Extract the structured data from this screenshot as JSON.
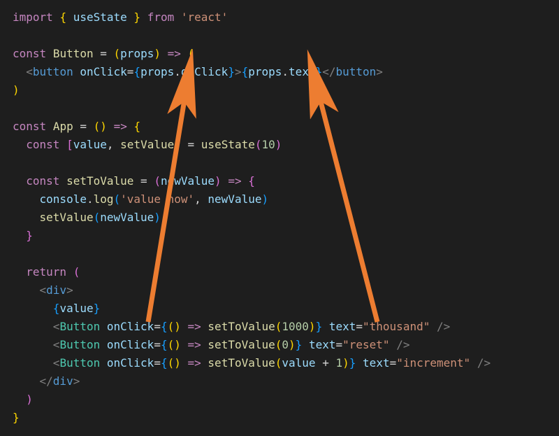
{
  "theme": {
    "background": "#1e1e1e",
    "keyword": "#c586c0",
    "variable": "#9cdcfe",
    "function": "#dcdcaa",
    "type": "#4ec9b0",
    "string": "#ce9178",
    "number": "#b5cea8",
    "tag_punct": "#808080",
    "element": "#569cd6",
    "brace_outer": "#ffd700",
    "brace_mid": "#da70d6",
    "brace_inner": "#179fff",
    "arrow_color": "#ed7d31"
  },
  "code": {
    "l1": {
      "import_kw": "import",
      "lbrace": "{",
      "useState": "useState",
      "rbrace": "}",
      "from_kw": "from",
      "react_str": "'react'"
    },
    "l3": {
      "const_kw": "const",
      "Button": "Button",
      "eq": "=",
      "lp": "(",
      "props": "props",
      "rp": ")",
      "arrow": "=>",
      "lp2": "("
    },
    "l4": {
      "lt": "<",
      "button_tag": "button",
      "sp": " ",
      "onClick_attr": "onClick",
      "eq": "=",
      "lb1": "{",
      "props1": "props",
      "dot1": ".",
      "onClick_prop": "onClick",
      "rb1": "}",
      "gt": ">",
      "lb2": "{",
      "props2": "props",
      "dot2": ".",
      "text_prop": "text",
      "rb2": "}",
      "lt2": "</",
      "button_tag2": "button",
      "gt2": ">"
    },
    "l5": {
      "rp": ")"
    },
    "l7": {
      "const_kw": "const",
      "App": "App",
      "eq": "=",
      "lp": "(",
      "rp": ")",
      "arrow": "=>",
      "lb": "{"
    },
    "l8": {
      "const_kw": "const",
      "lbr": "[",
      "value": "value",
      "comma": ",",
      "setValue": "setValue",
      "rbr": "]",
      "eq": "=",
      "useState": "useState",
      "lp": "(",
      "ten": "10",
      "rp": ")"
    },
    "l10": {
      "const_kw": "const",
      "setToValue": "setToValue",
      "eq": "=",
      "lp": "(",
      "newValue": "newValue",
      "rp": ")",
      "arrow": "=>",
      "lb": "{"
    },
    "l11": {
      "console": "console",
      "dot": ".",
      "log": "log",
      "lp": "(",
      "str": "'value now'",
      "comma": ",",
      "newValue": "newValue",
      "rp": ")"
    },
    "l12": {
      "setValue": "setValue",
      "lp": "(",
      "newValue": "newValue",
      "rp": ")"
    },
    "l13": {
      "rb": "}"
    },
    "l15": {
      "return_kw": "return",
      "lp": "("
    },
    "l16": {
      "lt": "<",
      "div": "div",
      "gt": ">"
    },
    "l17": {
      "lb": "{",
      "value": "value",
      "rb": "}"
    },
    "l18": {
      "lt": "<",
      "Button": "Button",
      "onClick": "onClick",
      "eq": "=",
      "lb": "{",
      "lp": "(",
      "rp": ")",
      "arrow": "=>",
      "setToValue": "setToValue",
      "lp2": "(",
      "arg": "1000",
      "rp2": ")",
      "rb": "}",
      "text_attr": "text",
      "eq2": "=",
      "text_val": "\"thousand\"",
      "close": "/>"
    },
    "l19": {
      "lt": "<",
      "Button": "Button",
      "onClick": "onClick",
      "eq": "=",
      "lb": "{",
      "lp": "(",
      "rp": ")",
      "arrow": "=>",
      "setToValue": "setToValue",
      "lp2": "(",
      "arg": "0",
      "rp2": ")",
      "rb": "}",
      "text_attr": "text",
      "eq2": "=",
      "text_val": "\"reset\"",
      "close": "/>"
    },
    "l20": {
      "lt": "<",
      "Button": "Button",
      "onClick": "onClick",
      "eq": "=",
      "lb": "{",
      "lp": "(",
      "rp": ")",
      "arrow": "=>",
      "setToValue": "setToValue",
      "lp2": "(",
      "value": "value",
      "plus": "+",
      "one": "1",
      "rp2": ")",
      "rb": "}",
      "text_attr": "text",
      "eq2": "=",
      "text_val": "\"increment\"",
      "close": "/>"
    },
    "l21": {
      "lt": "</",
      "div": "div",
      "gt": ">"
    },
    "l22": {
      "rp": ")"
    },
    "l23": {
      "rb": "}"
    }
  },
  "annotations": {
    "arrow1": {
      "type": "arrow",
      "from": "line18-onClick-area",
      "to": "props.onClick"
    },
    "arrow2": {
      "type": "arrow",
      "from": "line18-text-area",
      "to": "props.text"
    }
  }
}
